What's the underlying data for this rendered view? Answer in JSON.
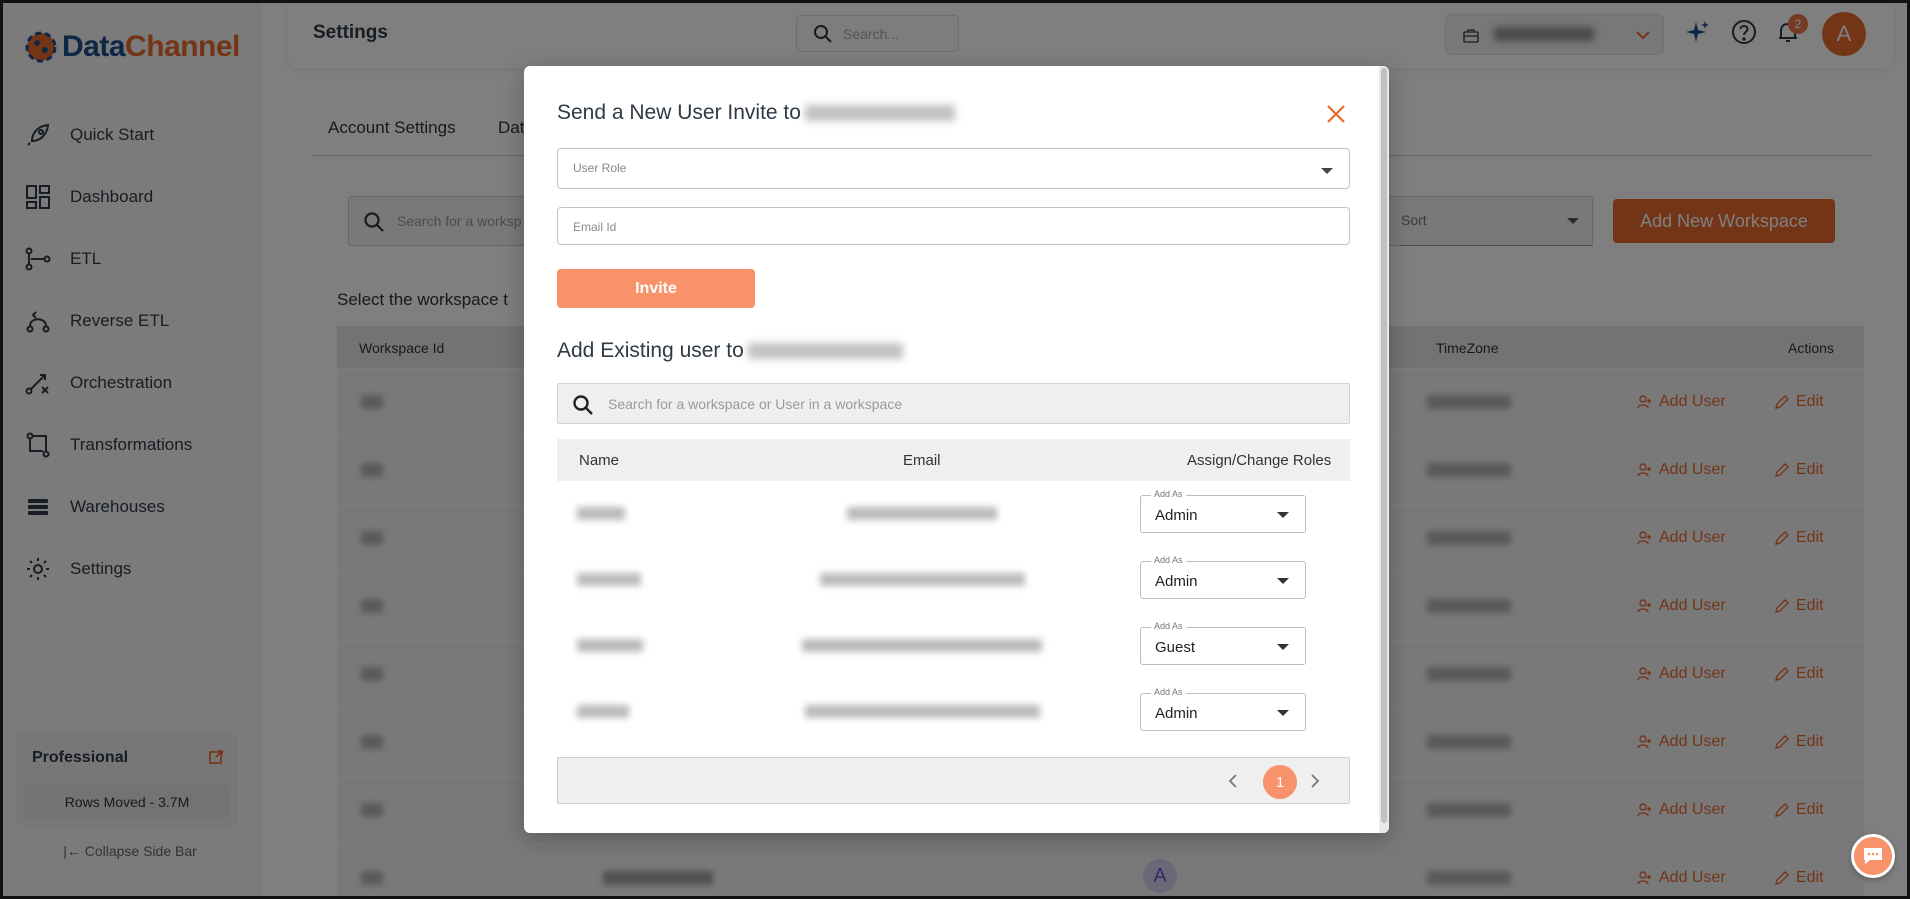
{
  "app": {
    "logo_part1": "Data",
    "logo_part2": "Channel"
  },
  "sidebar": {
    "items": [
      {
        "label": "Quick Start",
        "icon": "rocket-icon"
      },
      {
        "label": "Dashboard",
        "icon": "dashboard-icon"
      },
      {
        "label": "ETL",
        "icon": "etl-icon"
      },
      {
        "label": "Reverse ETL",
        "icon": "reverse-etl-icon"
      },
      {
        "label": "Orchestration",
        "icon": "orchestration-icon"
      },
      {
        "label": "Transformations",
        "icon": "transformations-icon"
      },
      {
        "label": "Warehouses",
        "icon": "warehouses-icon"
      },
      {
        "label": "Settings",
        "icon": "gear-icon"
      }
    ],
    "plan_title": "Professional",
    "rows_moved": "Rows Moved - 3.7M",
    "collapse_label": "Collapse Side Bar"
  },
  "header": {
    "title": "Settings",
    "search_placeholder": "Search...",
    "notification_count": "2",
    "avatar_letter": "A"
  },
  "page": {
    "tabs": [
      "Account Settings",
      "Dat"
    ],
    "search_placeholder": "Search for a worksp",
    "sort_label": "Sort",
    "add_workspace_label": "Add New Workspace",
    "select_prompt": "Select the workspace t",
    "table_headers": {
      "workspace_id": "Workspace Id",
      "timezone": "TimeZone",
      "actions": "Actions"
    },
    "row_add_user_label": "Add User",
    "row_edit_label": "Edit",
    "row_count": 8,
    "last_row_avatar": "A"
  },
  "modal": {
    "title": "Send a New User Invite to",
    "user_role_label": "User Role",
    "email_label": "Email Id",
    "invite_label": "Invite",
    "existing_title": "Add Existing user to",
    "search_placeholder": "Search for a workspace or User in a workspace",
    "columns": {
      "name": "Name",
      "email": "Email",
      "roles": "Assign/Change Roles"
    },
    "add_as_label": "Add As",
    "users": [
      {
        "role": "Admin"
      },
      {
        "role": "Admin"
      },
      {
        "role": "Guest"
      },
      {
        "role": "Admin"
      }
    ],
    "current_page": "1"
  },
  "colors": {
    "accent": "#e86a2c",
    "button_light": "#f7926a",
    "brand_blue": "#1e4e8c"
  }
}
